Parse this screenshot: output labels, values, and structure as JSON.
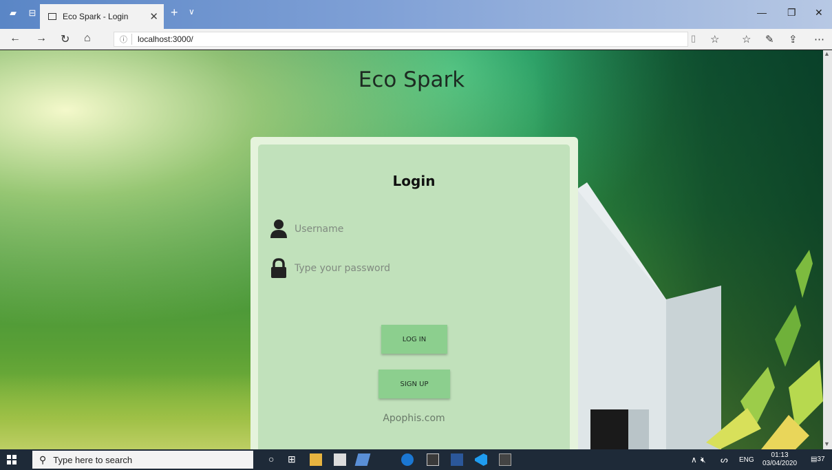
{
  "browser": {
    "tab_title": "Eco Spark - Login",
    "url": "localhost:3000/"
  },
  "page": {
    "site_title": "Eco Spark",
    "login": {
      "heading": "Login",
      "username_placeholder": "Username",
      "password_placeholder": "Type your password",
      "login_button": "LOG IN",
      "signup_button": "SIGN UP",
      "footer": "Apophis.com"
    }
  },
  "taskbar": {
    "search_placeholder": "Type here to search",
    "language": "ENG",
    "time": "01:13",
    "date": "03/04/2020",
    "notifications": "37"
  },
  "colors": {
    "card": "#c1e1bb",
    "button": "#8ccf8e",
    "taskbar": "#1e2a38"
  }
}
